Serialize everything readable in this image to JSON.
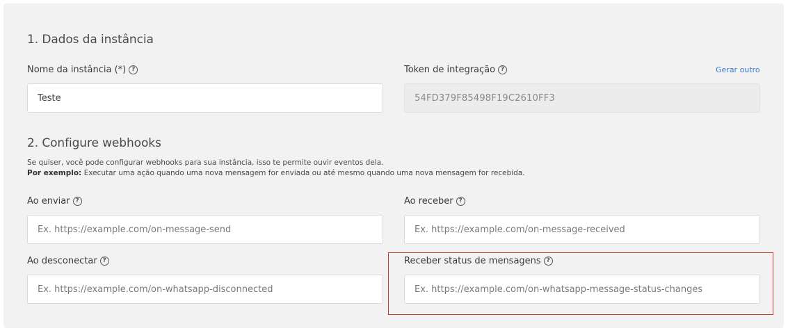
{
  "section1": {
    "title": "1. Dados da instância",
    "instance_name_label": "Nome da instância (*)",
    "instance_name_value": "Teste",
    "token_label": "Token de integração",
    "token_value": "54FD379F85498F19C2610FF3",
    "regenerate_link": "Gerar outro"
  },
  "section2": {
    "title": "2. Configure webhooks",
    "description": "Se quiser, você pode configurar webhooks para sua instância, isso te permite ouvir eventos dela.",
    "example_prefix": "Por exemplo:",
    "example_text": " Executar uma ação quando uma nova mensagem for enviada ou até mesmo quando uma nova mensagem for recebida.",
    "on_send_label": "Ao enviar",
    "on_send_placeholder": "Ex. https://example.com/on-message-send",
    "on_receive_label": "Ao receber",
    "on_receive_placeholder": "Ex. https://example.com/on-message-received",
    "on_disconnect_label": "Ao desconectar",
    "on_disconnect_placeholder": "Ex. https://example.com/on-whatsapp-disconnected",
    "status_label": "Receber status de mensagens",
    "status_placeholder": "Ex. https://example.com/on-whatsapp-message-status-changes"
  },
  "icons": {
    "help": "help-circle-icon"
  },
  "colors": {
    "panel_bg": "#f2f2f2",
    "link": "#3a7bc8",
    "highlight_border": "#c0392b"
  }
}
